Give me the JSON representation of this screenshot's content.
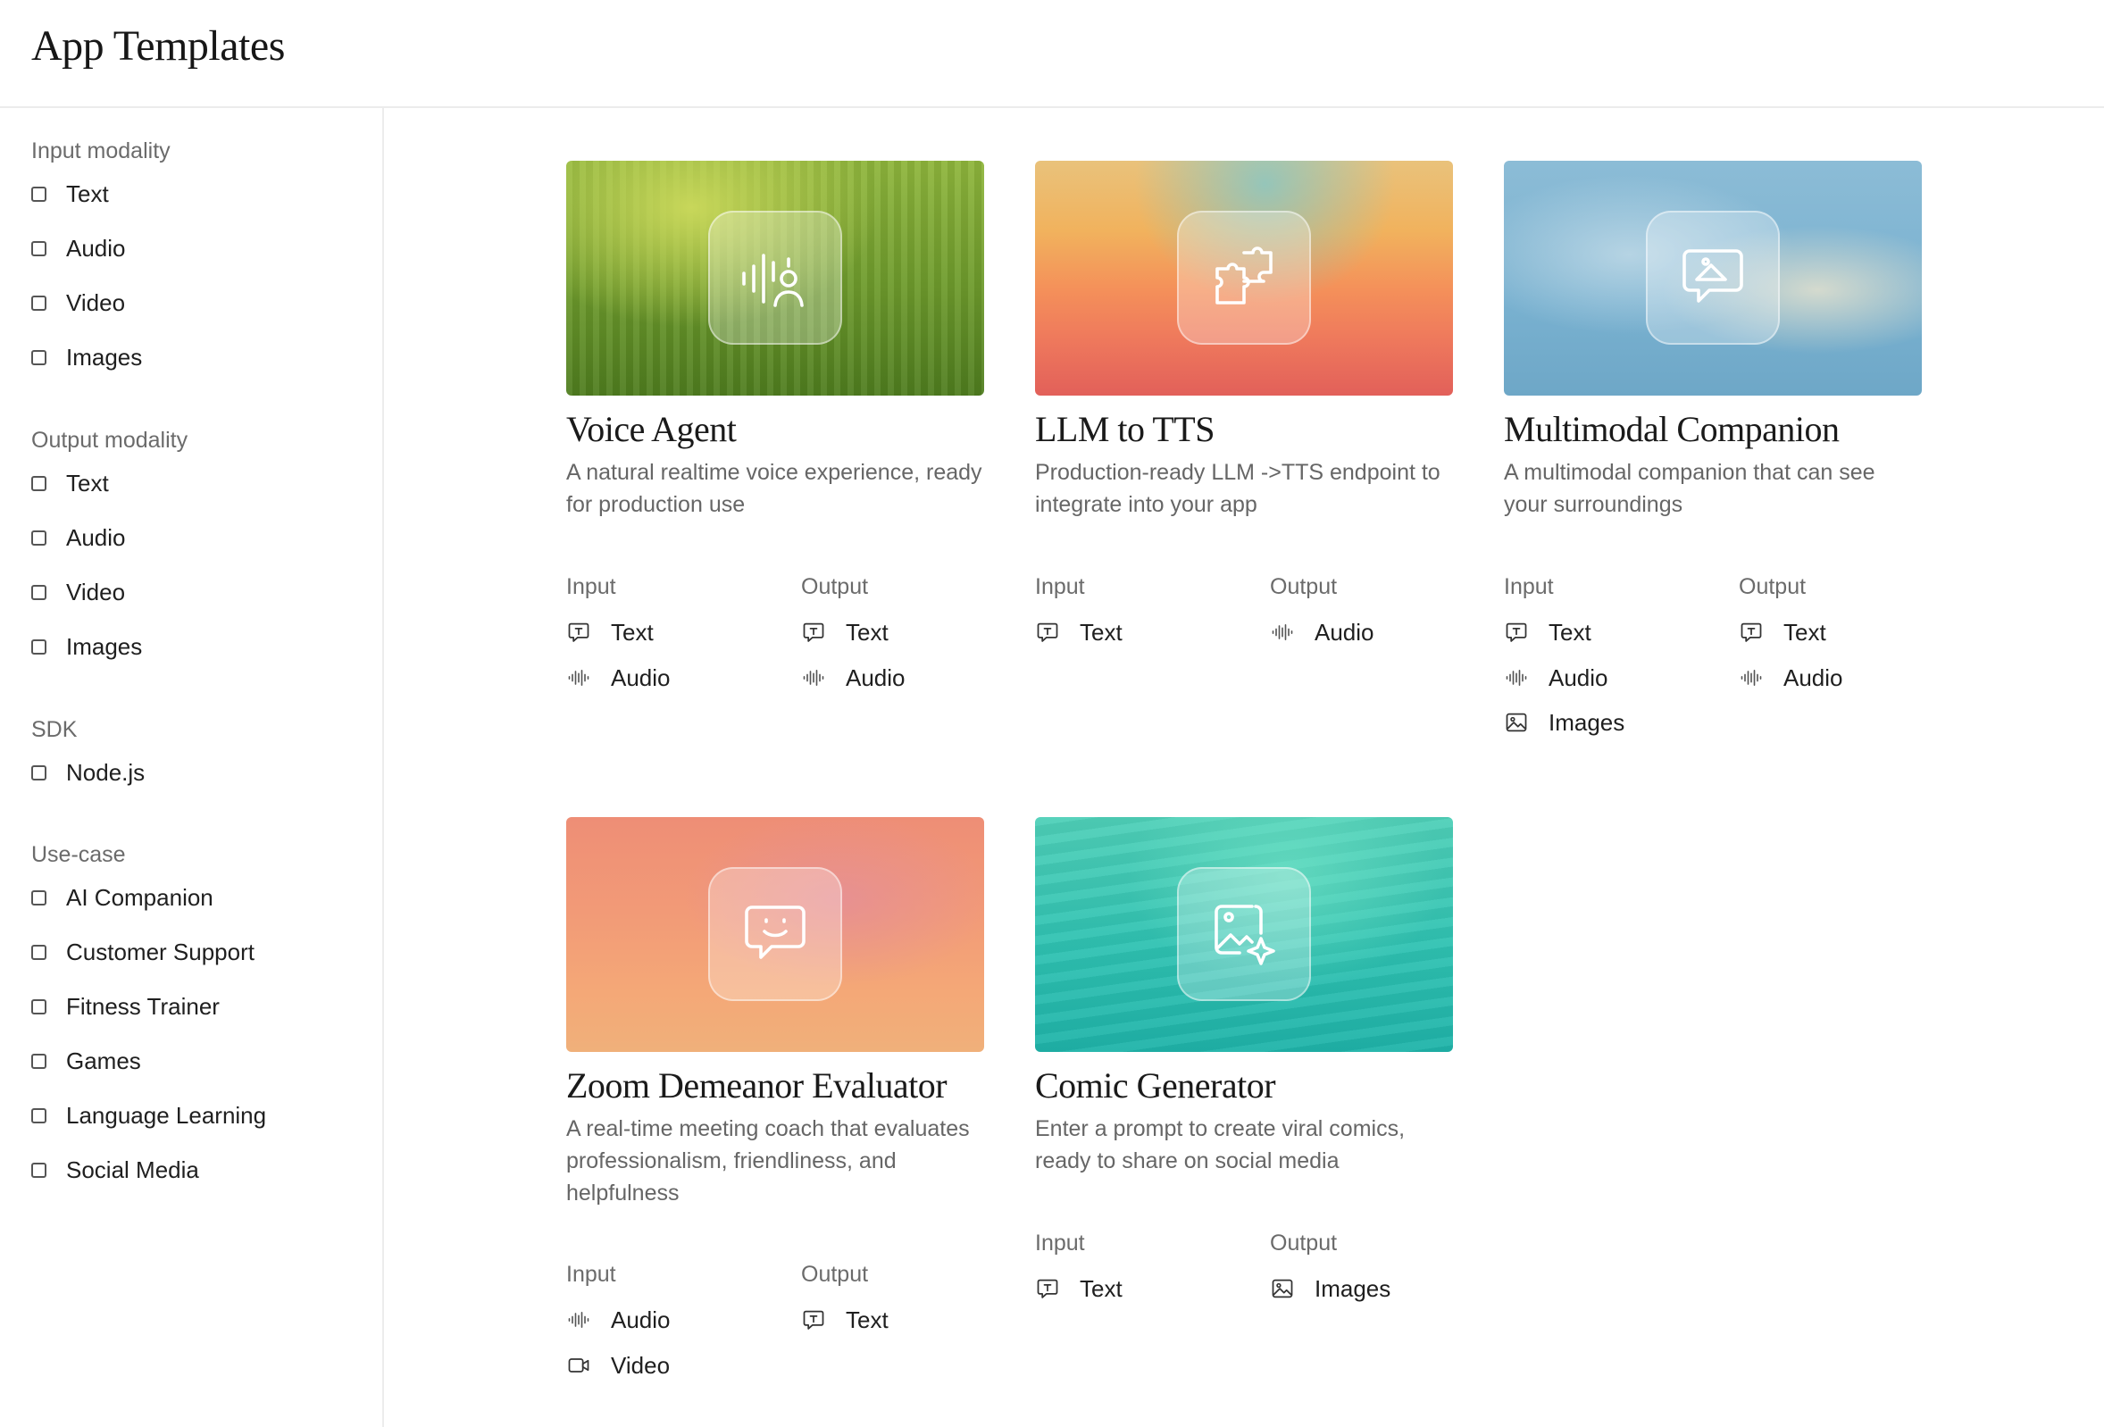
{
  "header": {
    "title": "App Templates"
  },
  "sidebar": {
    "groups": [
      {
        "heading": "Input modality",
        "options": [
          "Text",
          "Audio",
          "Video",
          "Images"
        ]
      },
      {
        "heading": "Output modality",
        "options": [
          "Text",
          "Audio",
          "Video",
          "Images"
        ]
      },
      {
        "heading": "SDK",
        "options": [
          "Node.js"
        ]
      },
      {
        "heading": "Use-case",
        "options": [
          "AI Companion",
          "Customer Support",
          "Fitness Trainer",
          "Games",
          "Language Learning",
          "Social Media"
        ]
      }
    ]
  },
  "io_labels": {
    "input": "Input",
    "output": "Output"
  },
  "cards": [
    {
      "title": "Voice Agent",
      "description": "A natural realtime voice experience, ready for production use",
      "icon": "voice-user-icon",
      "input": [
        {
          "label": "Text",
          "icon": "text-icon"
        },
        {
          "label": "Audio",
          "icon": "audio-icon"
        }
      ],
      "output": [
        {
          "label": "Text",
          "icon": "text-icon"
        },
        {
          "label": "Audio",
          "icon": "audio-icon"
        }
      ]
    },
    {
      "title": "LLM to TTS",
      "description": "Production-ready LLM ->TTS endpoint to integrate into your app",
      "icon": "puzzle-icon",
      "input": [
        {
          "label": "Text",
          "icon": "text-icon"
        }
      ],
      "output": [
        {
          "label": "Audio",
          "icon": "audio-icon"
        }
      ]
    },
    {
      "title": "Multimodal Companion",
      "description": "A multimodal companion that can see your surroundings",
      "icon": "image-chat-icon",
      "input": [
        {
          "label": "Text",
          "icon": "text-icon"
        },
        {
          "label": "Audio",
          "icon": "audio-icon"
        },
        {
          "label": "Images",
          "icon": "image-icon"
        }
      ],
      "output": [
        {
          "label": "Text",
          "icon": "text-icon"
        },
        {
          "label": "Audio",
          "icon": "audio-icon"
        }
      ]
    },
    {
      "title": "Zoom Demeanor Evaluator",
      "description": "A real-time meeting coach that evaluates professionalism, friendliness, and helpfulness",
      "icon": "smile-chat-icon",
      "input": [
        {
          "label": "Audio",
          "icon": "audio-icon"
        },
        {
          "label": "Video",
          "icon": "video-icon"
        }
      ],
      "output": [
        {
          "label": "Text",
          "icon": "text-icon"
        }
      ]
    },
    {
      "title": "Comic Generator",
      "description": "Enter a prompt to create viral comics, ready to share on social media",
      "icon": "image-sparkle-icon",
      "input": [
        {
          "label": "Text",
          "icon": "text-icon"
        }
      ],
      "output": [
        {
          "label": "Images",
          "icon": "image-icon"
        }
      ]
    }
  ]
}
